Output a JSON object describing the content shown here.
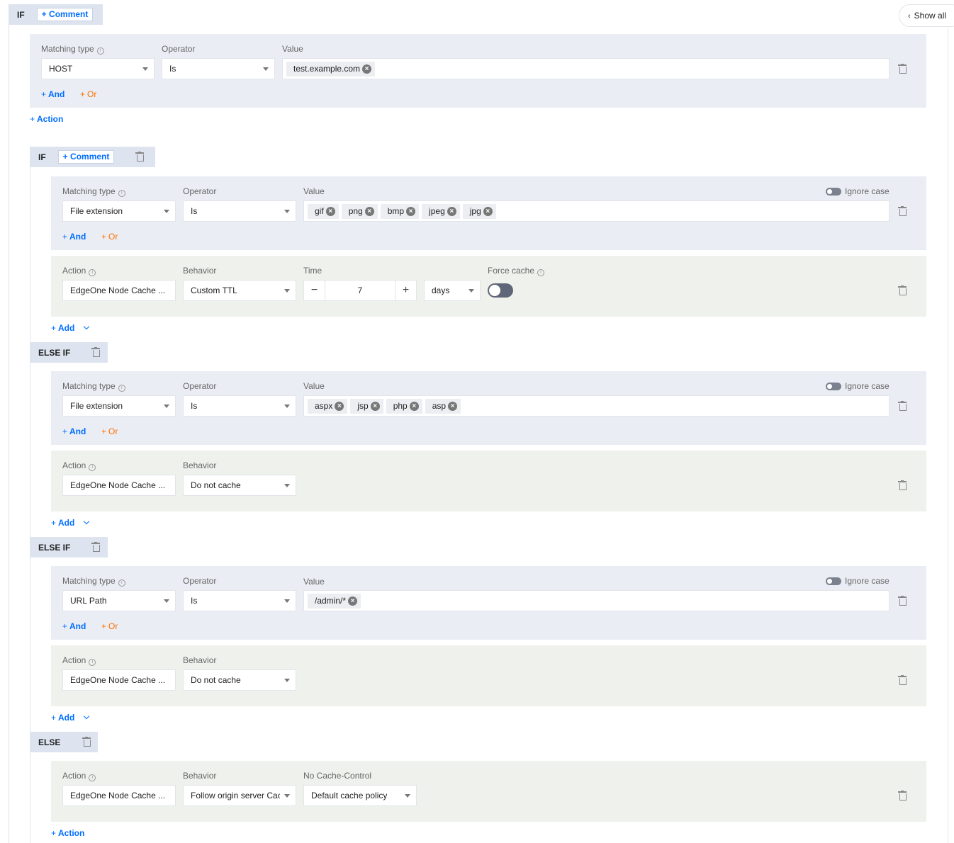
{
  "toolbar": {
    "show_all": "Show all"
  },
  "labels": {
    "if": "IF",
    "else_if": "ELSE IF",
    "else": "ELSE",
    "comment": "Comment",
    "matching_type": "Matching type",
    "operator": "Operator",
    "value": "Value",
    "action": "Action",
    "behavior": "Behavior",
    "time": "Time",
    "force_cache": "Force cache",
    "ignore_case": "Ignore case",
    "no_cache_control": "No Cache-Control",
    "and": "And",
    "or": "Or",
    "add": "Add",
    "add_action": "Action",
    "plus": "+"
  },
  "outer_rule": {
    "matching_type": "HOST",
    "operator": "Is",
    "values": [
      "test.example.com"
    ]
  },
  "branch1": {
    "condition": {
      "matching_type": "File extension",
      "operator": "Is",
      "values": [
        "gif",
        "png",
        "bmp",
        "jpeg",
        "jpg"
      ]
    },
    "action": {
      "name": "EdgeOne Node Cache ...",
      "behavior": "Custom TTL",
      "time": "7",
      "unit": "days",
      "force_cache": false
    }
  },
  "branch2": {
    "condition": {
      "matching_type": "File extension",
      "operator": "Is",
      "values": [
        "aspx",
        "jsp",
        "php",
        "asp"
      ]
    },
    "action": {
      "name": "EdgeOne Node Cache ...",
      "behavior": "Do not cache"
    }
  },
  "branch3": {
    "condition": {
      "matching_type": "URL Path",
      "operator": "Is",
      "values": [
        "/admin/*"
      ]
    },
    "action": {
      "name": "EdgeOne Node Cache ...",
      "behavior": "Do not cache"
    }
  },
  "else_branch": {
    "action": {
      "name": "EdgeOne Node Cache ...",
      "behavior": "Follow origin server Cac",
      "no_cache_control": "Default cache policy"
    }
  },
  "colors": {
    "accent": "#006eff",
    "or": "#ff7200",
    "condition_bg": "#eaedf4",
    "action_bg": "#eff1ec",
    "tag_bg": "#dde4f0"
  }
}
